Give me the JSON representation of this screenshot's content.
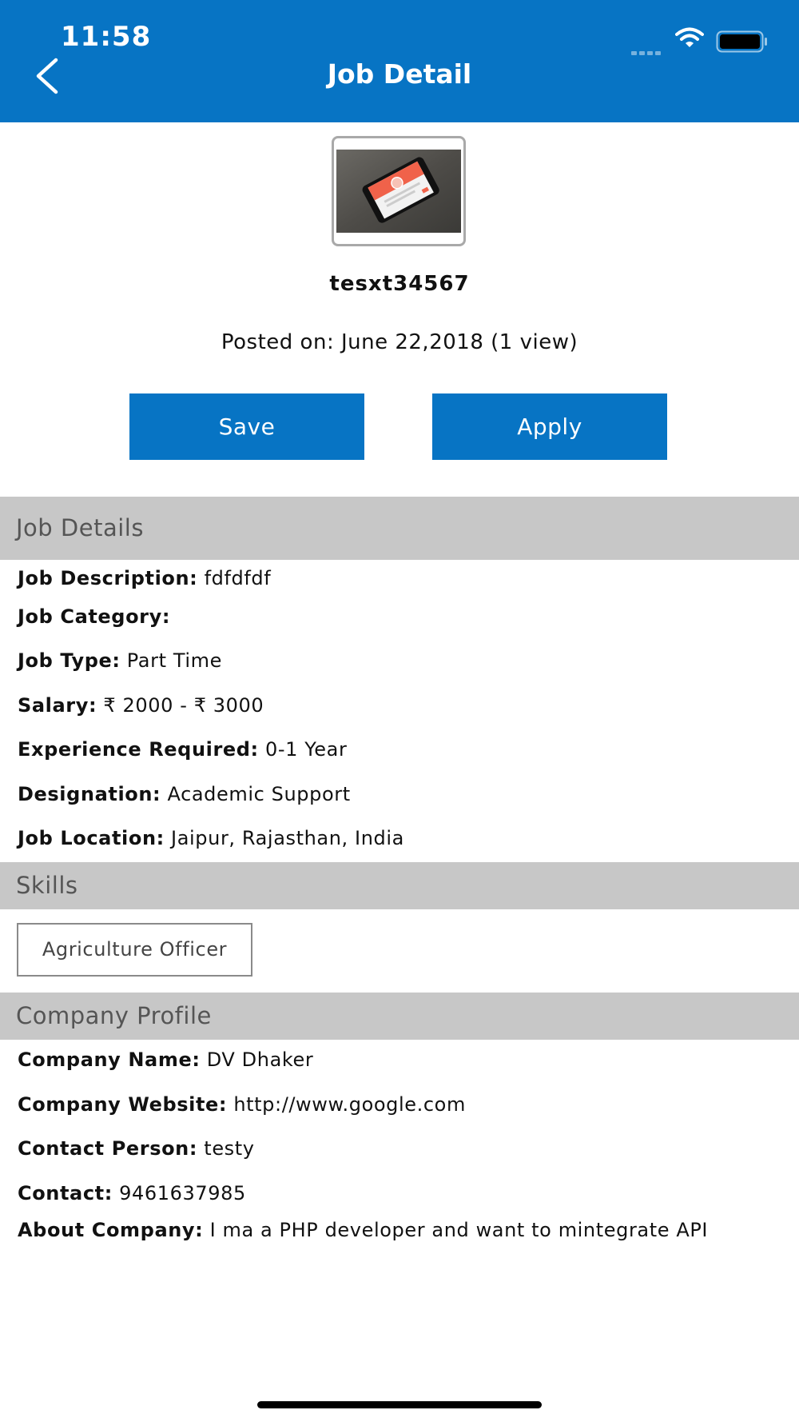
{
  "status_bar": {
    "time": "11:58"
  },
  "header": {
    "title": "Job Detail"
  },
  "job": {
    "id": "tesxt34567",
    "posted": "Posted on: June 22,2018 (1 view)"
  },
  "actions": {
    "save_label": "Save",
    "apply_label": "Apply"
  },
  "sections": {
    "job_details": "Job Details",
    "skills": "Skills",
    "company_profile": "Company Profile"
  },
  "job_details": [
    {
      "label": "Job Description:",
      "value": " fdfdfdf"
    },
    {
      "label": "Job Category:",
      "value": ""
    },
    {
      "label": "Job Type:",
      "value": " Part Time"
    },
    {
      "label": "Salary:",
      "value": " ₹ 2000 - ₹ 3000"
    },
    {
      "label": "Experience Required:",
      "value": " 0-1 Year"
    },
    {
      "label": "Designation:",
      "value": " Academic Support"
    },
    {
      "label": "Job Location:",
      "value": " Jaipur, Rajasthan, India"
    }
  ],
  "skills": [
    "Agriculture Officer"
  ],
  "company": [
    {
      "label": "Company Name:",
      "value": " DV Dhaker"
    },
    {
      "label": "Company Website:",
      "value": " http://www.google.com"
    },
    {
      "label": "Contact Person:",
      "value": " testy"
    },
    {
      "label": "Contact:",
      "value": " 9461637985"
    },
    {
      "label": "About Company:",
      "value": " I ma a PHP developer and want to mintegrate API"
    }
  ],
  "colors": {
    "primary": "#0774c4",
    "section_bg": "#c7c7c7"
  },
  "icons": [
    "back-chevron-icon",
    "signal-icon",
    "wifi-icon",
    "battery-icon"
  ]
}
